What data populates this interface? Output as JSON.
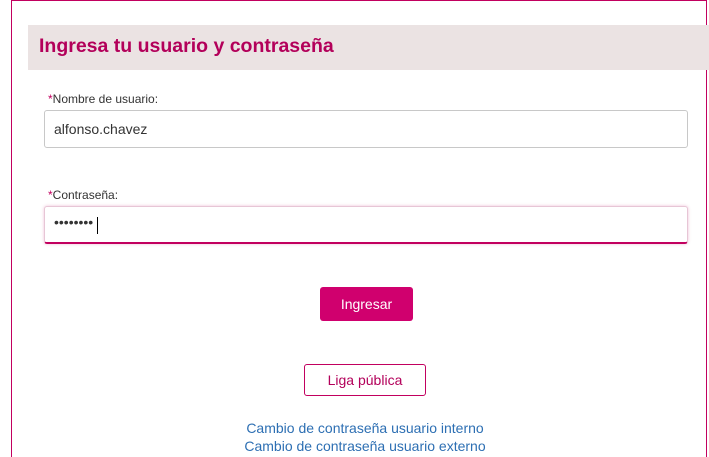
{
  "form": {
    "title": "Ingresa tu usuario y contraseña",
    "username": {
      "required_mark": "*",
      "label": "Nombre de usuario:",
      "value": "alfonso.chavez"
    },
    "password": {
      "required_mark": "*",
      "label": "Contraseña:",
      "masked_value": "••••••••"
    },
    "submit_label": "Ingresar",
    "public_link_label": "Liga pública",
    "links": {
      "internal_password_change": "Cambio de contraseña usuario interno",
      "external_password_change": "Cambio de contraseña usuario externo"
    }
  },
  "colors": {
    "accent": "#c2005f",
    "button_fill": "#d0006e",
    "header_bg": "#ebe3e3",
    "title_color": "#b3005a",
    "link_color": "#2d6fb3"
  }
}
